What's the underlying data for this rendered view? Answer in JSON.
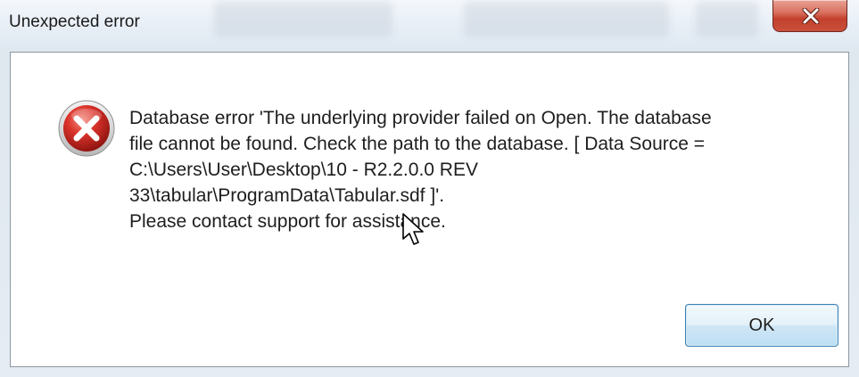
{
  "window": {
    "title": "Unexpected error"
  },
  "icons": {
    "close": "close-icon",
    "error": "error-icon",
    "cursor": "mouse-cursor-icon"
  },
  "message": {
    "lines": [
      "Database error 'The underlying provider failed on Open. The database",
      "file cannot be found. Check the path to the database. [ Data Source =",
      "C:\\Users\\User\\Desktop\\10 - R2.2.0.0 REV",
      "33\\tabular\\ProgramData\\Tabular.sdf ]'.",
      "Please contact support for assistance."
    ]
  },
  "buttons": {
    "ok_label": "OK"
  },
  "colors": {
    "close_button": "#c94f3a",
    "error_icon": "#d3372f",
    "ok_button_border": "#3c7fb1"
  }
}
